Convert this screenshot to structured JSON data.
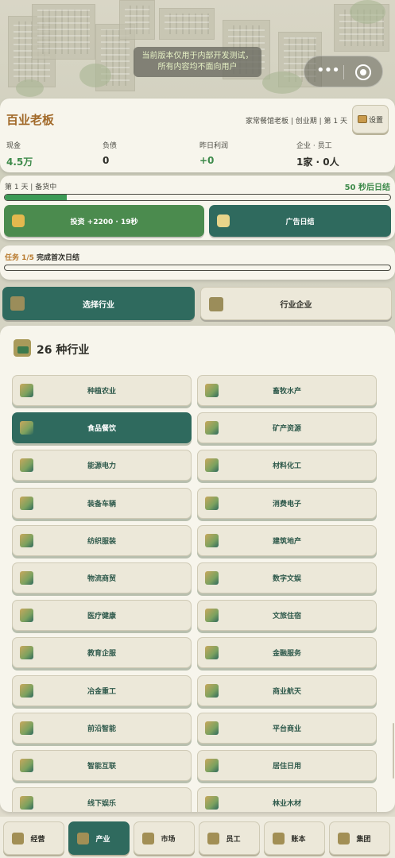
{
  "notice": {
    "line1": "当前版本仅用于内部开发测试，",
    "line2": "所有内容均不面向用户"
  },
  "capsule": {
    "more": "•••"
  },
  "header": {
    "title": "百业老板",
    "subtitle": "家常餐馆老板 | 创业期 | 第 1 天",
    "settings_label": "设置",
    "stats": [
      {
        "label": "现金",
        "value": "4.5万",
        "color": "#3d8a4a"
      },
      {
        "label": "负债",
        "value": "0",
        "color": "#2e2e28"
      },
      {
        "label": "昨日利润",
        "value": "+0",
        "color": "#3d8a4a"
      },
      {
        "label": "企业 · 员工",
        "value": "1家 · 0人",
        "color": "#2e2e28"
      }
    ]
  },
  "progress": {
    "day_status": "第 1 天 | 备货中",
    "countdown": "50 秒后日结",
    "fraction": 0.16,
    "invest_label": "投资 +2200 · 19秒",
    "ad_label": "广告日结"
  },
  "task": {
    "counter": "任务 1/5",
    "title": "完成首次日结"
  },
  "tabs": {
    "active": "选择行业",
    "other": "行业企业"
  },
  "industries": {
    "title": "26 种行业",
    "items": [
      "种植农业",
      "畜牧水产",
      "食品餐饮",
      "矿产资源",
      "能源电力",
      "材料化工",
      "装备车辆",
      "消费电子",
      "纺织服装",
      "建筑地产",
      "物流商贸",
      "数字文娱",
      "医疗健康",
      "文旅住宿",
      "教育企服",
      "金融服务",
      "冶金重工",
      "商业航天",
      "前沿智能",
      "平台商业",
      "智能互联",
      "居住日用",
      "线下娱乐",
      "林业木材"
    ],
    "selected_index": 2
  },
  "nav": {
    "items": [
      "经营",
      "产业",
      "市场",
      "员工",
      "账本",
      "集团"
    ],
    "active_index": 1
  },
  "colors": {
    "primary": "#2f6a5e",
    "green": "#4b8b4e",
    "gold": "#a26a2a"
  }
}
